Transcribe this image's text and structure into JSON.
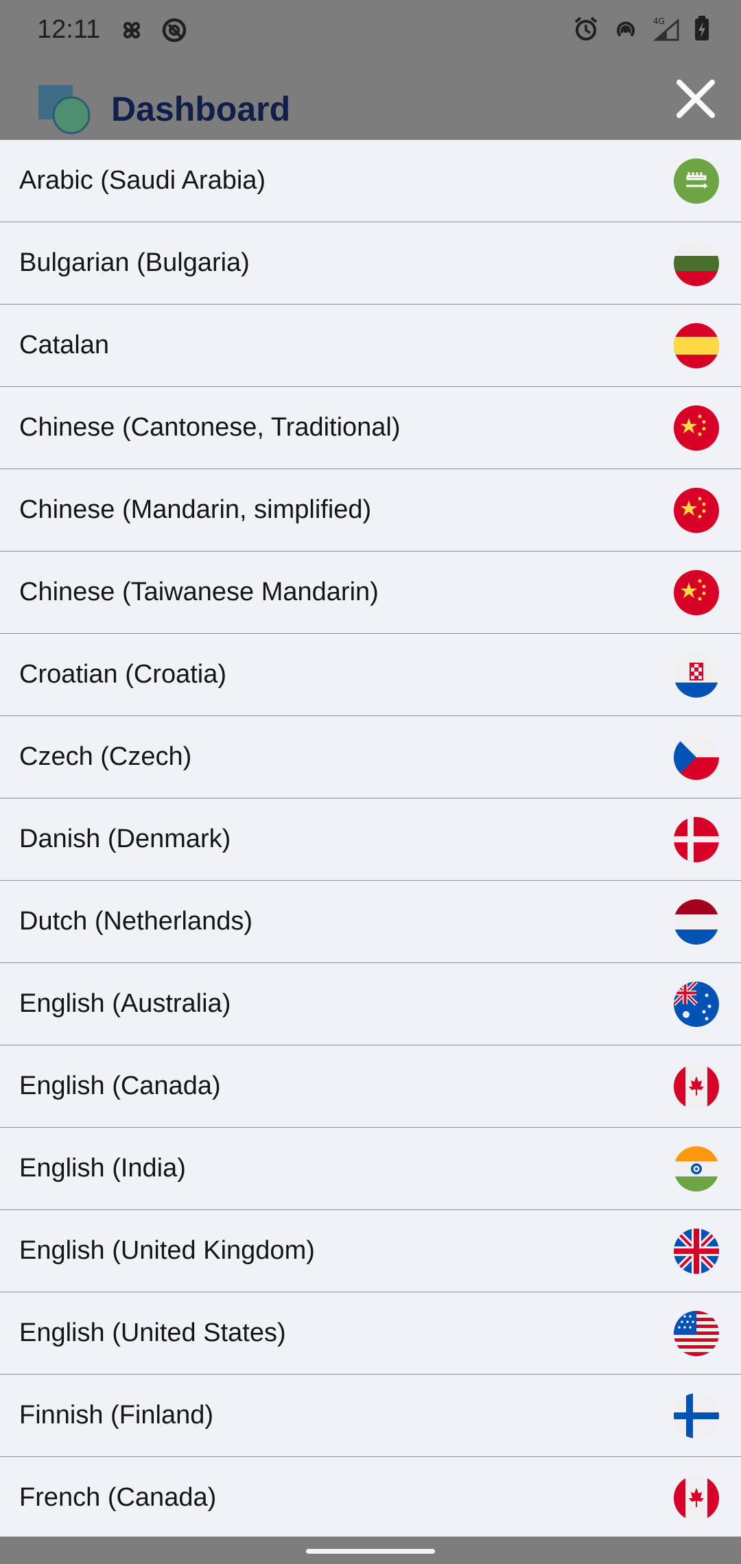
{
  "status_bar": {
    "time": "12:11",
    "left_icons": [
      "pinwheel-icon",
      "at-sign-icon"
    ],
    "right_icons": [
      "alarm-icon",
      "hotspot-icon",
      "signal-4g-icon",
      "battery-charging-icon"
    ],
    "network_label": "4G"
  },
  "header": {
    "title": "Dashboard",
    "close_icon": "close-icon"
  },
  "colors": {
    "sheet_bg": "#f1f2f7",
    "scrim": "#7d7d7d",
    "title": "#0f1f4a",
    "divider": "#8b8b8b"
  },
  "languages": [
    {
      "label": "Arabic (Saudi Arabia)",
      "flag": "saudi-arabia-flag-icon"
    },
    {
      "label": "Bulgarian (Bulgaria)",
      "flag": "bulgaria-flag-icon"
    },
    {
      "label": "Catalan",
      "flag": "spain-flag-icon"
    },
    {
      "label": "Chinese (Cantonese, Traditional)",
      "flag": "china-flag-icon"
    },
    {
      "label": "Chinese (Mandarin, simplified)",
      "flag": "china-flag-icon"
    },
    {
      "label": "Chinese (Taiwanese Mandarin)",
      "flag": "china-flag-icon"
    },
    {
      "label": "Croatian (Croatia)",
      "flag": "croatia-flag-icon"
    },
    {
      "label": "Czech (Czech)",
      "flag": "czech-flag-icon"
    },
    {
      "label": "Danish (Denmark)",
      "flag": "denmark-flag-icon"
    },
    {
      "label": "Dutch (Netherlands)",
      "flag": "netherlands-flag-icon"
    },
    {
      "label": "English (Australia)",
      "flag": "australia-flag-icon"
    },
    {
      "label": "English (Canada)",
      "flag": "canada-flag-icon"
    },
    {
      "label": "English (India)",
      "flag": "india-flag-icon"
    },
    {
      "label": "English (United Kingdom)",
      "flag": "uk-flag-icon"
    },
    {
      "label": "English (United States)",
      "flag": "usa-flag-icon"
    },
    {
      "label": "Finnish (Finland)",
      "flag": "finland-flag-icon"
    },
    {
      "label": "French (Canada)",
      "flag": "canada-flag-icon"
    }
  ]
}
